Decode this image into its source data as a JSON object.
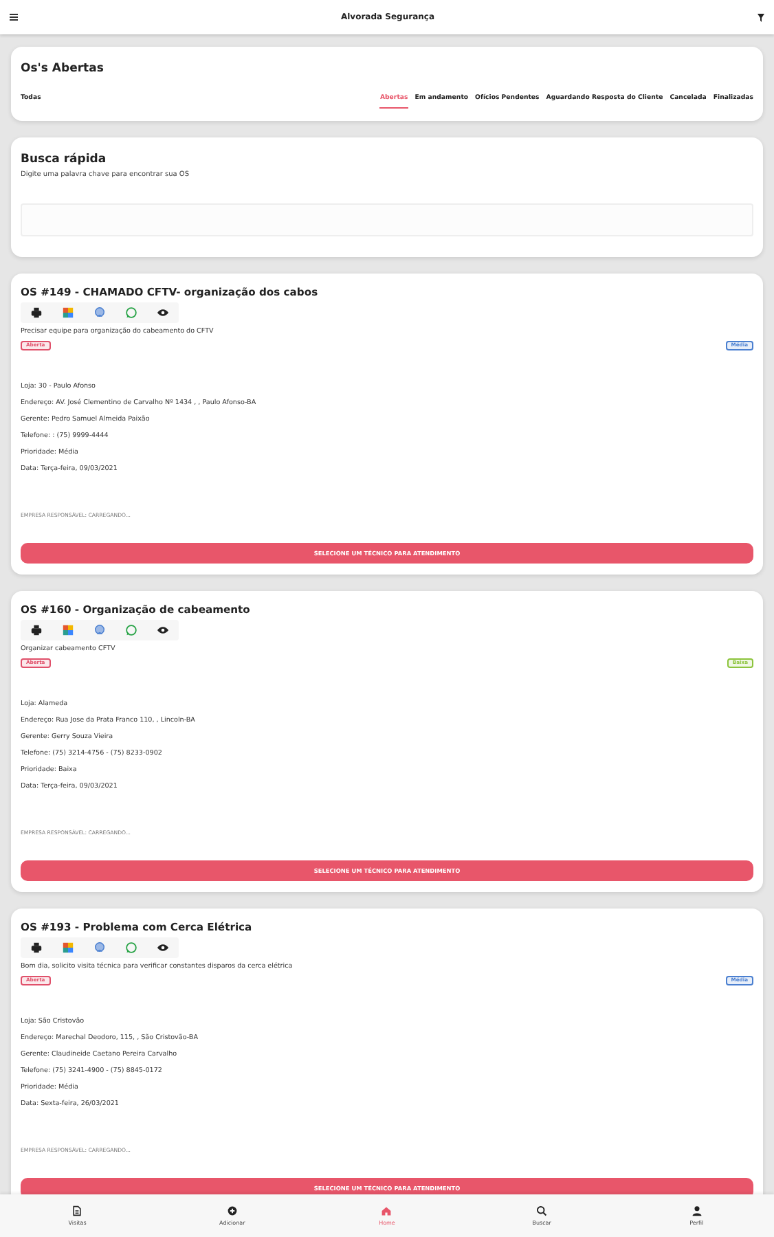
{
  "header": {
    "title": "Alvorada Segurança"
  },
  "status_panel": {
    "title": "Os's Abertas",
    "tabs": [
      {
        "label": "Todas",
        "selected": false
      },
      {
        "label": "Abertas",
        "selected": true
      },
      {
        "label": "Em andamento",
        "selected": false
      },
      {
        "label": "Ofícios Pendentes",
        "selected": false
      },
      {
        "label": "Aguardando Resposta do Cliente",
        "selected": false
      },
      {
        "label": "Cancelada",
        "selected": false
      },
      {
        "label": "Finalizadas",
        "selected": false
      }
    ]
  },
  "search_panel": {
    "title": "Busca rápida",
    "hint": "Digite uma palavra chave para encontrar sua OS"
  },
  "orders": [
    {
      "title": "OS #149 - CHAMADO CFTV- organização dos cabos",
      "description": "Precisar equipe para organização do cabeamento do CFTV",
      "status_badge": {
        "label": "Aberta",
        "color": "#e0506a"
      },
      "priority_badge": {
        "label": "Média",
        "color": "#4a7fd0"
      },
      "details": [
        "Loja: 30 - Paulo Afonso",
        "Endereço: AV. José Clementino de Carvalho Nº 1434 , , Paulo Afonso-BA",
        "Gerente: Pedro Samuel Almeida Paixão",
        "Telefone: : (75) 9999-4444",
        "Prioridade: Média",
        "Data: Terça-feira, 09/03/2021"
      ],
      "company": "EMPRESA RESPONSÁVEL: CARREGANDO...",
      "button": "SELECIONE UM TÉCNICO PARA ATENDIMENTO"
    },
    {
      "title": "OS #160 - Organização de cabeamento",
      "description": "Organizar cabeamento CFTV",
      "status_badge": {
        "label": "Aberta",
        "color": "#e0506a"
      },
      "priority_badge": {
        "label": "Baixa",
        "color": "#8cc43c"
      },
      "details": [
        "Loja: Alameda",
        "Endereço: Rua Jose da Prata Franco 110, , Lincoln-BA",
        "Gerente: Gerry Souza Vieira",
        "Telefone: (75) 3214-4756 - (75) 8233-0902",
        "Prioridade: Baixa",
        "Data: Terça-feira, 09/03/2021"
      ],
      "company": "EMPRESA RESPONSÁVEL: CARREGANDO...",
      "button": "SELECIONE UM TÉCNICO PARA ATENDIMENTO"
    },
    {
      "title": "OS #193 - Problema com Cerca Elétrica",
      "description": "Bom dia, solicito visita técnica para verificar constantes disparos da cerca elétrica",
      "status_badge": {
        "label": "Aberta",
        "color": "#e0506a"
      },
      "priority_badge": {
        "label": "Média",
        "color": "#4a7fd0"
      },
      "details": [
        "Loja: São Cristovão",
        "Endereço: Marechal Deodoro, 115, , São Cristovão-BA",
        "Gerente: Claudineide Caetano Pereira Carvalho",
        "Telefone: (75) 3241-4900 - (75) 8845-0172",
        "Prioridade: Média",
        "Data: Sexta-feira, 26/03/2021"
      ],
      "company": "EMPRESA RESPONSÁVEL: CARREGANDO...",
      "button": "SELECIONE UM TÉCNICO PARA ATENDIMENTO"
    }
  ],
  "bottom_nav": [
    {
      "kind": "visits",
      "label": "Visitas",
      "selected": false
    },
    {
      "kind": "add",
      "label": "Adicionar",
      "selected": false
    },
    {
      "kind": "home",
      "label": "Home",
      "selected": true
    },
    {
      "kind": "search",
      "label": "Buscar",
      "selected": false
    },
    {
      "kind": "profile",
      "label": "Perfil",
      "selected": false
    }
  ]
}
